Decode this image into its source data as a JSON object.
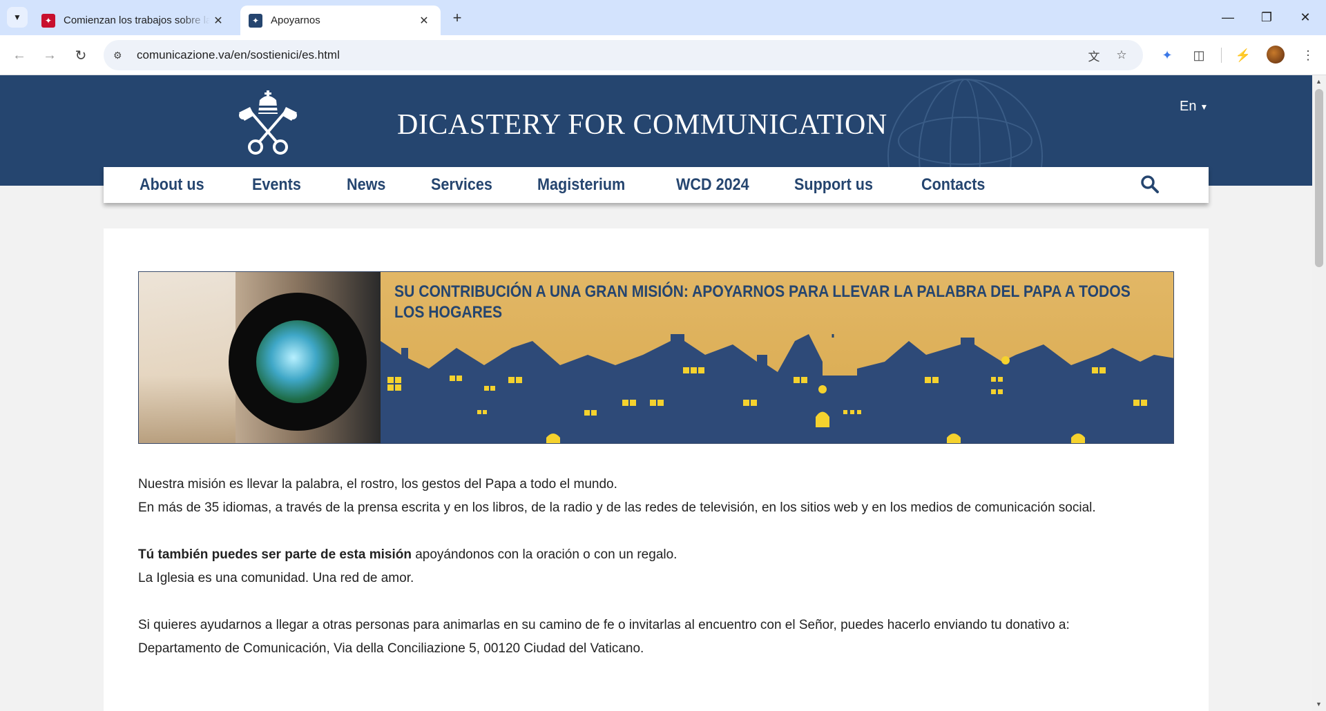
{
  "browser": {
    "tabs": [
      {
        "title": "Comienzan los trabajos sobre la",
        "active": false
      },
      {
        "title": "Apoyarnos",
        "active": true
      }
    ],
    "url": "comunicazione.va/en/sostienici/es.html"
  },
  "header": {
    "site_title": "DICASTERY FOR COMMUNICATION",
    "language": "En"
  },
  "nav": {
    "items": [
      "About us",
      "Events",
      "News",
      "Services",
      "Magisterium",
      "WCD 2024",
      "Support us",
      "Contacts"
    ]
  },
  "banner": {
    "title": "SU CONTRIBUCIÓN A UNA GRAN MISIÓN: APOYARNOS PARA LLEVAR LA PALABRA DEL PAPA A TODOS LOS HOGARES"
  },
  "body": {
    "p1_line1": "Nuestra misión es llevar la palabra, el rostro, los gestos del Papa a todo el mundo.",
    "p1_line2": "En más de 35 idiomas, a través de la prensa escrita y en los libros, de la radio y de las redes de televisión, en los sitios web y en los medios de comunicación social.",
    "p2_bold": "Tú también puedes ser parte de esta misión",
    "p2_rest": " apoyándonos con la oración o con un regalo.",
    "p2_line2": "La Iglesia es una comunidad. Una red de amor.",
    "p3_line1": "Si quieres ayudarnos a llegar a otras personas para animarlas en su camino de fe o invitarlas al encuentro con el Señor, puedes hacerlo enviando tu donativo a:",
    "p3_line2": "Departamento de Comunicación, Via della Conciliazione 5, 00120 Ciudad del Vaticano."
  },
  "colors": {
    "brand_blue": "#25456f",
    "banner_gold": "#dcae58",
    "window_yellow": "#f5d22e"
  }
}
